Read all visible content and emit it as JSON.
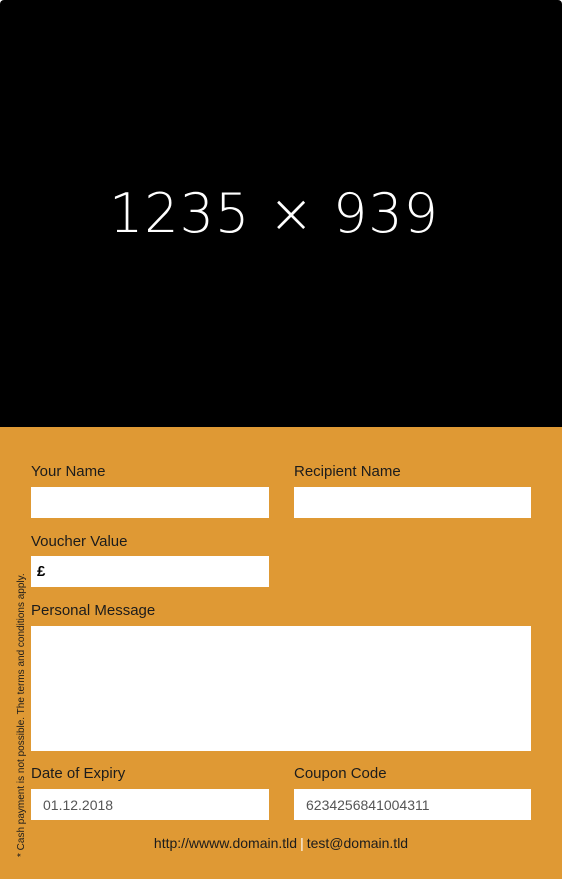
{
  "hero": {
    "placeholder_text": "1235 × 939",
    "background": "#000000"
  },
  "form": {
    "background": "#df9934",
    "your_name": {
      "label": "Your Name",
      "value": ""
    },
    "recipient_name": {
      "label": "Recipient Name",
      "value": ""
    },
    "voucher_value": {
      "label": "Voucher Value",
      "currency": "£",
      "value": ""
    },
    "personal_message": {
      "label": "Personal Message",
      "value": ""
    },
    "date_of_expiry": {
      "label": "Date of Expiry",
      "value": "01.12.2018"
    },
    "coupon_code": {
      "label": "Coupon Code",
      "value": "6234256841004311"
    }
  },
  "side_note": "* Cash payment is not possible. The terms and conditions apply.",
  "footer": {
    "website": "http://wwww.domain.tld",
    "separator": "|",
    "email": "test@domain.tld"
  }
}
